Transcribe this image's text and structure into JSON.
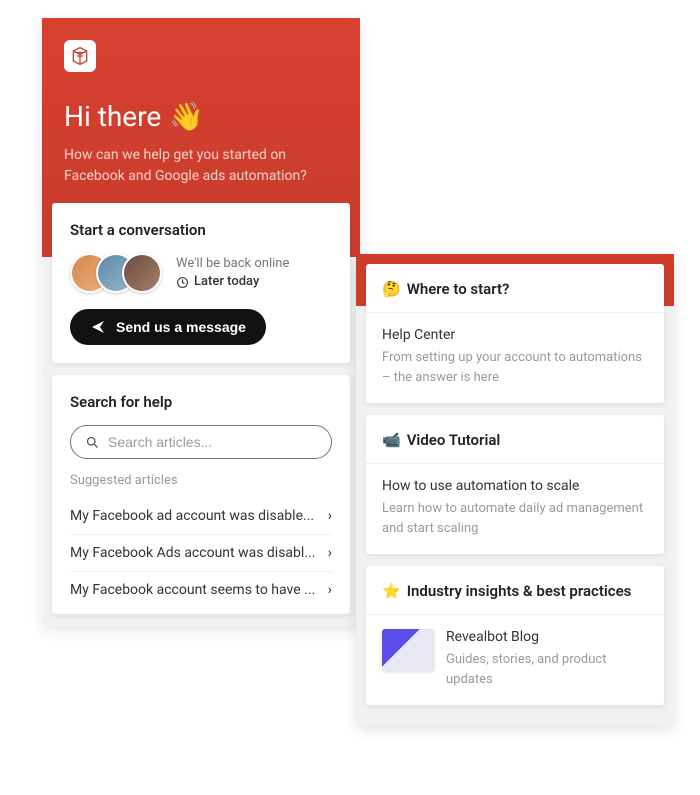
{
  "left": {
    "greeting": "Hi there",
    "wave_emoji": "👋",
    "subtitle": "How can we help get you started on Facebook and Google ads automation?",
    "conversation": {
      "title": "Start a conversation",
      "status_line1": "We'll be back online",
      "status_line2": "Later today",
      "button_label": "Send us a message"
    },
    "search": {
      "title": "Search for help",
      "placeholder": "Search articles...",
      "suggested_label": "Suggested articles",
      "articles": [
        "My Facebook ad account was disable...",
        "My Facebook Ads account was disabl...",
        "My Facebook account seems to have ..."
      ]
    }
  },
  "right": {
    "sections": [
      {
        "emoji": "🤔",
        "header": "Where to start?",
        "title": "Help Center",
        "sub": "From setting up your account to automations – the answer is here"
      },
      {
        "emoji": "📹",
        "header": "Video Tutorial",
        "title": "How to use automation to scale",
        "sub": "Learn how to automate daily ad management and start scaling"
      },
      {
        "emoji": "⭐",
        "header": "Industry insights & best practices",
        "title": "Revealbot Blog",
        "sub": "Guides, stories, and product updates"
      }
    ]
  }
}
